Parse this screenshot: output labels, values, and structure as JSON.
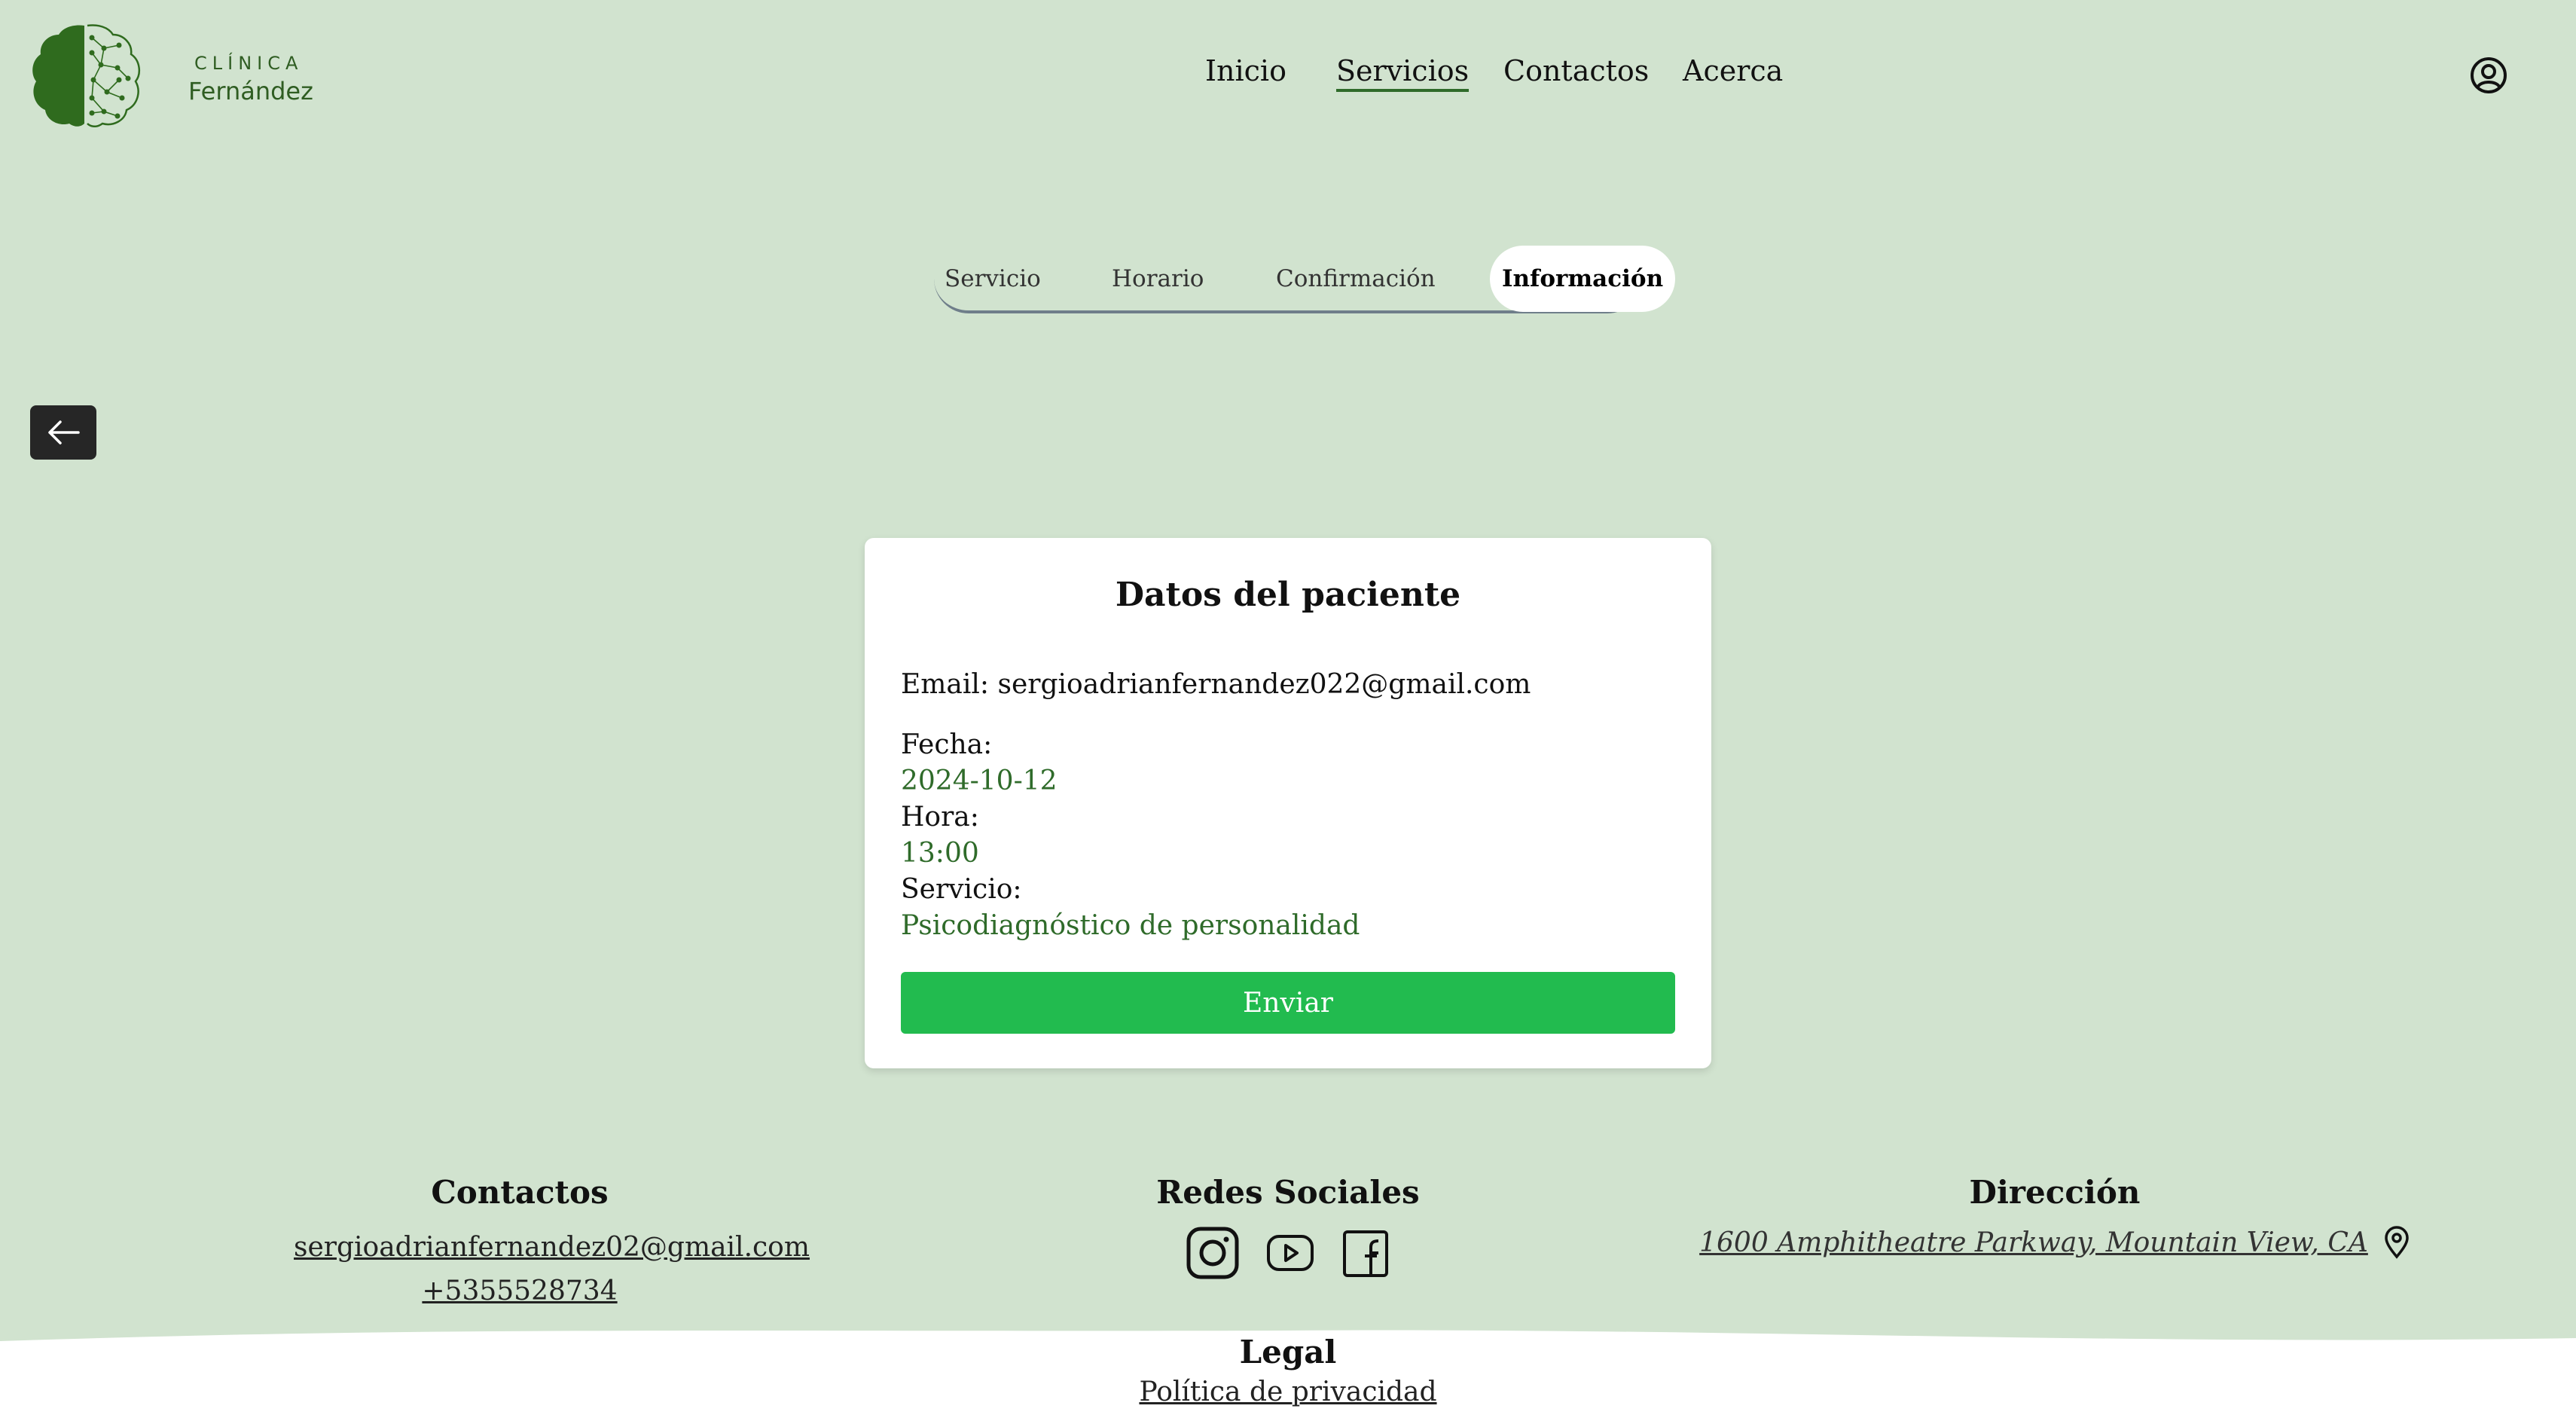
{
  "header": {
    "logo_top": "CLÍNICA",
    "logo_bottom": "Fernández",
    "nav": [
      "Inicio",
      "Servicios",
      "Contactos",
      "Acerca"
    ],
    "active_nav": "Servicios",
    "user_icon": "user-circle-icon"
  },
  "stepper": {
    "steps": [
      "Servicio",
      "Horario",
      "Confirmación",
      "Información"
    ],
    "active_step": "Información"
  },
  "back_button": {
    "icon": "arrow-left-icon"
  },
  "card": {
    "title": "Datos del paciente",
    "email_label": "Email:",
    "email_value": "sergioadrianfernandez022@gmail.com",
    "fecha_label": "Fecha:",
    "fecha_value": "2024-10-12",
    "hora_label": "Hora:",
    "hora_value": "13:00",
    "servicio_label": "Servicio:",
    "servicio_value": "Psicodiagnóstico de personalidad",
    "submit_label": "Enviar"
  },
  "footer": {
    "contacts_heading": "Contactos",
    "contacts_email": "sergioadrianfernandez02@gmail.com",
    "contacts_phone": "+5355528734",
    "social_heading": "Redes Sociales",
    "social_icons": [
      "instagram-icon",
      "youtube-icon",
      "facebook-icon"
    ],
    "address_heading": "Dirección",
    "address_value": "1600 Amphitheatre Parkway, Mountain View, CA",
    "legal_heading": "Legal",
    "privacy_link": "Política de privacidad"
  },
  "colors": {
    "background": "#d1e3cf",
    "brand_green": "#2f6b2a",
    "button_green": "#22bb4f",
    "back_button": "#262626"
  }
}
